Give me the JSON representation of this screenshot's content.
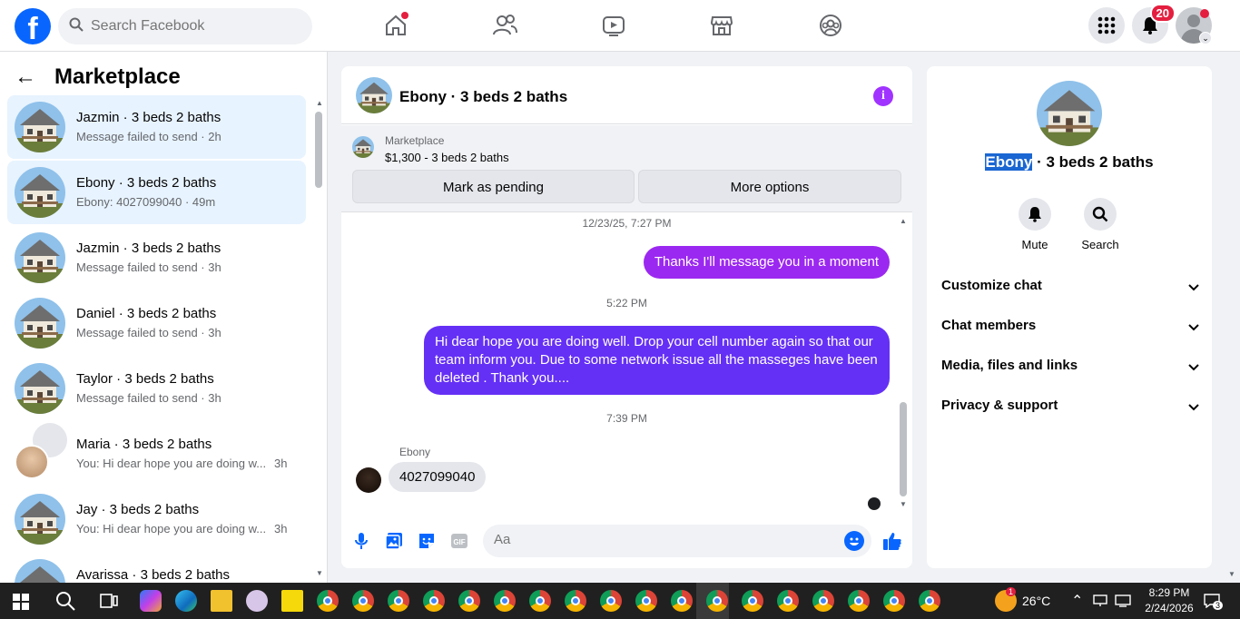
{
  "header": {
    "search_placeholder": "Search Facebook",
    "notification_count": "20",
    "logo_letter": "f"
  },
  "sidebar": {
    "title": "Marketplace",
    "conversations": [
      {
        "title": "Jazmin · 3 beds 2 baths",
        "subtitle": "Message failed to send · 2h",
        "time": "",
        "active": true
      },
      {
        "title": "Ebony · 3 beds 2 baths",
        "subtitle": "Ebony: 4027099040 · 49m",
        "time": "",
        "active": true
      },
      {
        "title": "Jazmin · 3 beds 2 baths",
        "subtitle": "Message failed to send · 3h",
        "time": ""
      },
      {
        "title": "Daniel · 3 beds 2 baths",
        "subtitle": "Message failed to send · 3h",
        "time": ""
      },
      {
        "title": "Taylor · 3 beds 2 baths",
        "subtitle": "Message failed to send · 3h",
        "time": ""
      },
      {
        "title": "Maria · 3 beds 2 baths",
        "subtitle": "You: Hi dear hope you are doing w...",
        "time": "3h"
      },
      {
        "title": "Jay · 3 beds 2 baths",
        "subtitle": "You: Hi dear hope you are doing w...",
        "time": "3h"
      },
      {
        "title": "Avarissa · 3 beds 2 baths",
        "subtitle": "",
        "time": ""
      }
    ]
  },
  "chat": {
    "title": "Ebony · 3 beds 2 baths",
    "marketplace_label": "Marketplace",
    "listing": "$1,300 - 3 beds 2 baths",
    "mark_pending_label": "Mark as pending",
    "more_options_label": "More options",
    "messages": [
      {
        "type": "timestamp",
        "text": "12/23/25, 7:27 PM"
      },
      {
        "type": "out",
        "text": "Thanks I'll message you in a moment"
      },
      {
        "type": "timestamp",
        "text": "5:22 PM"
      },
      {
        "type": "out",
        "text": "Hi dear hope you are doing well.  Drop your cell number again so that our team  inform you.  Due to some network issue all the masseges have been deleted . Thank you...."
      },
      {
        "type": "timestamp",
        "text": "7:39 PM"
      },
      {
        "type": "in",
        "sender": "Ebony",
        "text": "4027099040"
      }
    ],
    "composer_placeholder": "Aa"
  },
  "details": {
    "name_highlight": "Ebony",
    "name_rest": " · 3 beds 2 baths",
    "mute_label": "Mute",
    "search_label": "Search",
    "sections": [
      "Customize chat",
      "Chat members",
      "Media, files and links",
      "Privacy & support"
    ]
  },
  "taskbar": {
    "temperature": "26°C",
    "time": "8:29 PM",
    "date": "2/24/2026",
    "notification_count": "3",
    "weather_badge": "1"
  },
  "colors": {
    "accent": "#0866ff",
    "outgoing_purple": "#9b28f0",
    "outgoing_blue": "#6530f5",
    "info_icon": "#a033ff"
  }
}
